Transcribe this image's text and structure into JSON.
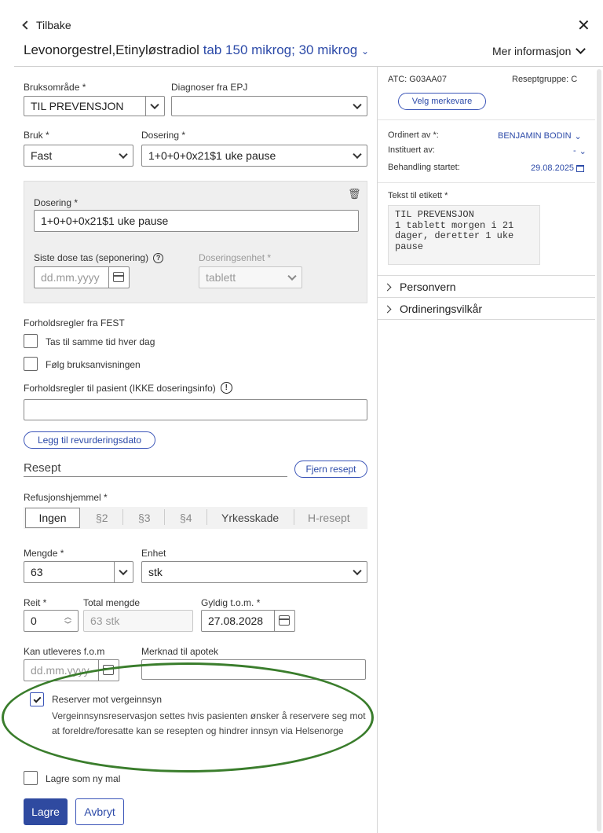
{
  "header": {
    "back_label": "Tilbake",
    "drug_name": "Levonorgestrel,Etinyløstradiol",
    "drug_strength": "tab 150 mikrog; 30 mikrog",
    "more_info": "Mer informasjon"
  },
  "form": {
    "bruksomrade_label": "Bruksområde *",
    "bruksomrade_value": "TIL PREVENSJON",
    "diagnoser_label": "Diagnoser fra EPJ",
    "diagnoser_value": "",
    "bruk_label": "Bruk *",
    "bruk_value": "Fast",
    "dosering_label": "Dosering *",
    "dosering_value": "1+0+0+0x21$1 uke pause",
    "dosering_box": {
      "label": "Dosering *",
      "value": "1+0+0+0x21$1 uke pause",
      "siste_dose_label": "Siste dose tas (seponering)",
      "siste_dose_placeholder": "dd.mm.yyyy",
      "doseringsenhet_label": "Doseringsenhet *",
      "doseringsenhet_value": "tablett"
    },
    "forholdsregler_fest_label": "Forholdsregler fra FEST",
    "fest_items": [
      "Tas til samme tid hver dag",
      "Følg bruksanvisningen"
    ],
    "forholdsregler_pasient_label": "Forholdsregler til pasient (IKKE doseringsinfo)",
    "forholdsregler_pasient_value": "",
    "revurdering_button": "Legg til revurderingsdato",
    "resept_heading": "Resept",
    "fjern_resept_button": "Fjern resept",
    "refusjon_label": "Refusjonshjemmel *",
    "refusjon_options": [
      "Ingen",
      "§2",
      "§3",
      "§4",
      "Yrkesskade",
      "H-resept"
    ],
    "refusjon_selected": "Ingen",
    "mengde_label": "Mengde *",
    "mengde_value": "63",
    "enhet_label": "Enhet",
    "enhet_value": "stk",
    "reit_label": "Reit *",
    "reit_value": "0",
    "total_mengde_label": "Total mengde",
    "total_mengde_value": "63 stk",
    "gyldig_label": "Gyldig t.o.m. *",
    "gyldig_value": "27.08.2028",
    "utleveres_label": "Kan utleveres f.o.m",
    "utleveres_placeholder": "dd.mm.yyyy",
    "merknad_label": "Merknad til apotek",
    "merknad_value": "",
    "reserver_label": "Reserver mot vergeinnsyn",
    "reserver_checked": true,
    "reserver_help": "Vergeinnsynsreservasjon settes hvis pasienten ønsker å reservere seg mot at foreldre/foresatte kan se resepten og hindrer innsyn via Helsenorge",
    "lagre_mal_label": "Lagre som ny mal",
    "save_button": "Lagre",
    "cancel_button": "Avbryt"
  },
  "side": {
    "atc": "ATC: G03AA07",
    "reseptgruppe": "Reseptgruppe: C",
    "merkevare_button": "Velg merkevare",
    "ordinert_label": "Ordinert av *:",
    "ordinert_value": "BENJAMIN BODIN",
    "instituert_label": "Instituert av:",
    "instituert_value": "-",
    "behandling_label": "Behandling startet:",
    "behandling_value": "29.08.2025",
    "etikett_label": "Tekst til etikett *",
    "etikett_text": "TIL PREVENSJON\n1 tablett morgen i 21\ndager, deretter 1 uke\npause",
    "sections": [
      "Personvern",
      "Ordineringsvilkår"
    ]
  },
  "colors": {
    "accent": "#2c4aa8",
    "primary_button": "#2f4aa0",
    "highlight_ring": "#3a7d2c"
  }
}
